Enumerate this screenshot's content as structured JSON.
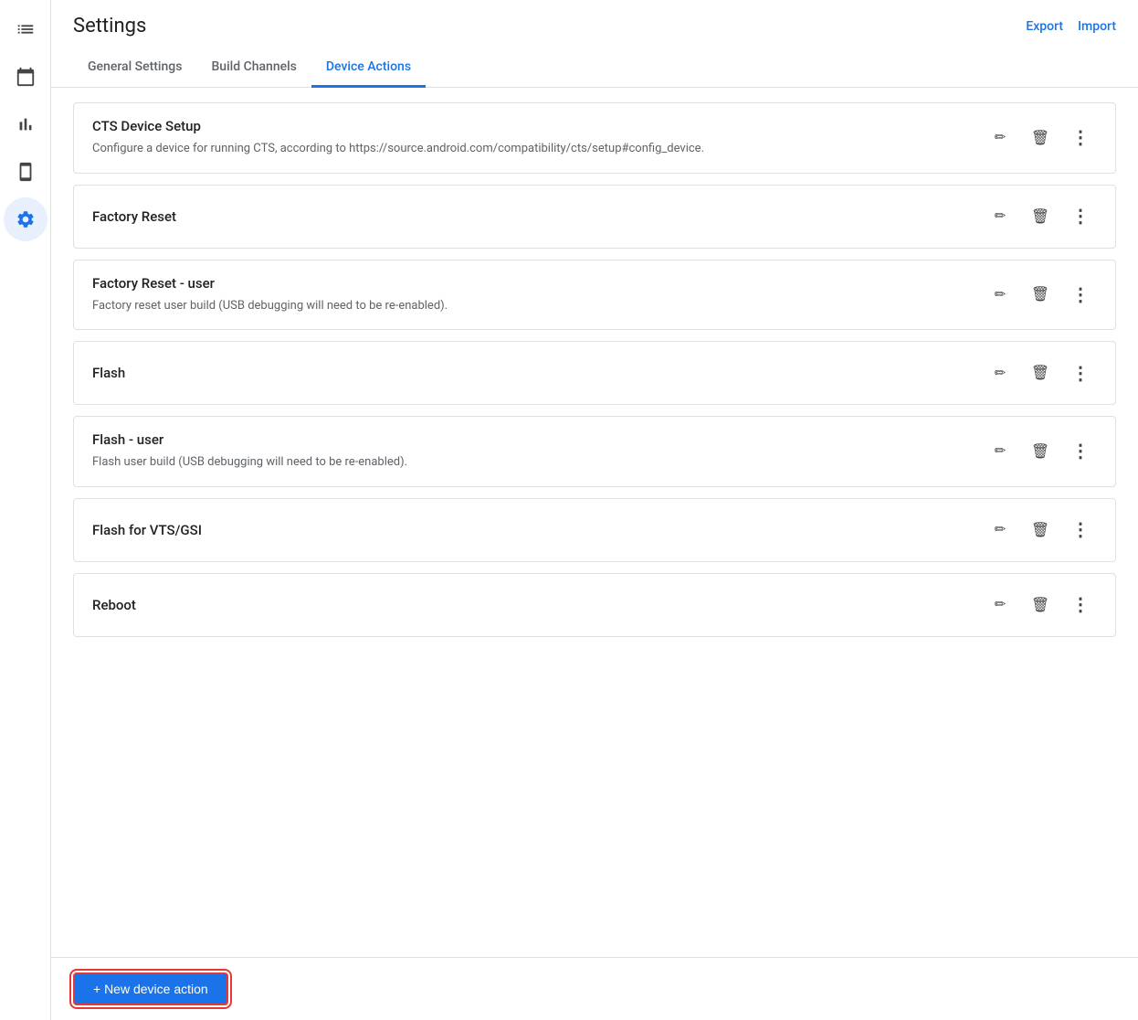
{
  "header": {
    "title": "Settings",
    "export_label": "Export",
    "import_label": "Import"
  },
  "tabs": [
    {
      "id": "general",
      "label": "General Settings",
      "active": false
    },
    {
      "id": "build-channels",
      "label": "Build Channels",
      "active": false
    },
    {
      "id": "device-actions",
      "label": "Device Actions",
      "active": true
    }
  ],
  "actions": [
    {
      "id": "cts-device-setup",
      "title": "CTS Device Setup",
      "description": "Configure a device for running CTS, according to https://source.android.com/compatibility/cts/setup#config_device."
    },
    {
      "id": "factory-reset",
      "title": "Factory Reset",
      "description": ""
    },
    {
      "id": "factory-reset-user",
      "title": "Factory Reset - user",
      "description": "Factory reset user build (USB debugging will need to be re-enabled)."
    },
    {
      "id": "flash",
      "title": "Flash",
      "description": ""
    },
    {
      "id": "flash-user",
      "title": "Flash - user",
      "description": "Flash user build (USB debugging will need to be re-enabled)."
    },
    {
      "id": "flash-vts-gsi",
      "title": "Flash for VTS/GSI",
      "description": ""
    },
    {
      "id": "reboot",
      "title": "Reboot",
      "description": ""
    }
  ],
  "footer": {
    "new_action_label": "+ New device action"
  },
  "sidebar": {
    "items": [
      {
        "id": "list",
        "icon": "list-icon"
      },
      {
        "id": "calendar",
        "icon": "calendar-icon"
      },
      {
        "id": "chart",
        "icon": "chart-icon"
      },
      {
        "id": "phone",
        "icon": "phone-icon"
      },
      {
        "id": "settings",
        "icon": "settings-icon",
        "active": true
      }
    ]
  }
}
